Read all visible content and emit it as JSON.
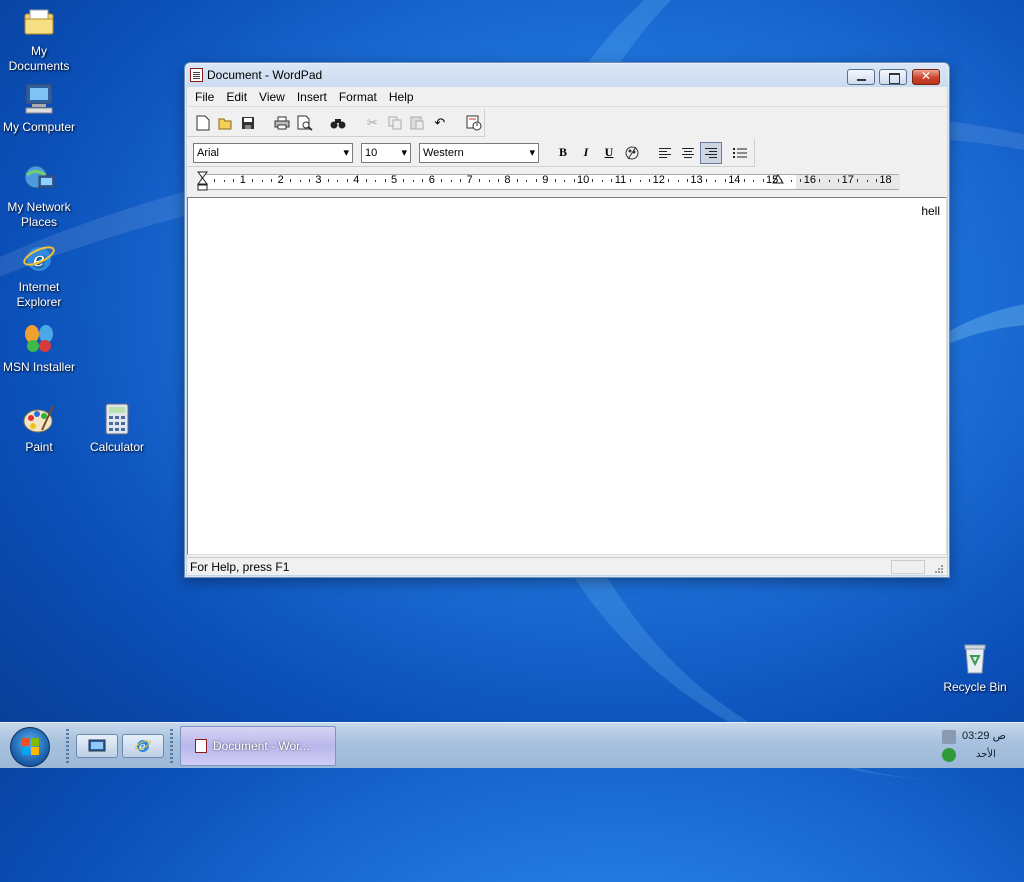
{
  "desktop": {
    "icons": [
      {
        "label": "My Documents",
        "icon": "folder-documents-icon"
      },
      {
        "label": "My Computer",
        "icon": "computer-icon"
      },
      {
        "label": "My Network Places",
        "icon": "network-icon"
      },
      {
        "label": "Internet Explorer",
        "icon": "ie-icon"
      },
      {
        "label": "MSN Installer",
        "icon": "msn-butterfly-icon"
      },
      {
        "label": "Paint",
        "icon": "paint-palette-icon"
      },
      {
        "label": "Calculator",
        "icon": "calculator-icon"
      },
      {
        "label": "Recycle Bin",
        "icon": "recycle-bin-icon"
      }
    ]
  },
  "window": {
    "title": "Document - WordPad",
    "menu": [
      "File",
      "Edit",
      "View",
      "Insert",
      "Format",
      "Help"
    ],
    "font_name": "Arial",
    "font_size": "10",
    "script": "Western",
    "ruler_numbers": [
      "1",
      "2",
      "3",
      "4",
      "5",
      "6",
      "7",
      "8",
      "9",
      "10",
      "11",
      "12",
      "13",
      "14",
      "15",
      "16",
      "17",
      "18"
    ],
    "document_text": "hell",
    "status": "For Help, press F1",
    "alignment_selected": "right"
  },
  "taskbar": {
    "task_label": "Document - Wor...",
    "clock_time": "03:29 ص",
    "clock_day": "الأحد"
  },
  "colors": {
    "desktop_blue": "#1f74dc",
    "close_red": "#c9452b"
  }
}
